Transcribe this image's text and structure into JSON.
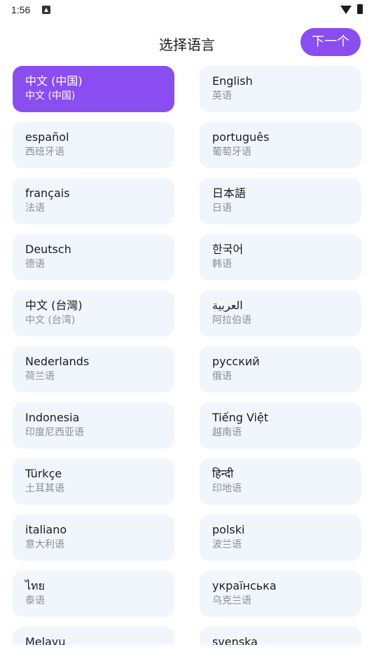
{
  "status_bar": {
    "time": "1:56",
    "notification_icon": "notification-icon",
    "wifi_icon": "wifi-icon",
    "battery_icon": "battery-icon"
  },
  "header": {
    "title": "选择语言",
    "next_label": "下一个"
  },
  "colors": {
    "accent": "#8a4df0",
    "card_bg": "#f1f6fd",
    "subtitle": "#8d8d94"
  },
  "languages": [
    {
      "native": "中文 (中国)",
      "zh": "中文 (中国)",
      "selected": true
    },
    {
      "native": "English",
      "zh": "英语",
      "selected": false
    },
    {
      "native": "español",
      "zh": "西班牙语",
      "selected": false
    },
    {
      "native": "português",
      "zh": "葡萄牙语",
      "selected": false
    },
    {
      "native": "français",
      "zh": "法语",
      "selected": false
    },
    {
      "native": "日本語",
      "zh": "日语",
      "selected": false
    },
    {
      "native": "Deutsch",
      "zh": "德语",
      "selected": false
    },
    {
      "native": "한국어",
      "zh": "韩语",
      "selected": false
    },
    {
      "native": "中文 (台灣)",
      "zh": "中文 (台湾)",
      "selected": false
    },
    {
      "native": "العربية",
      "zh": "阿拉伯语",
      "selected": false
    },
    {
      "native": "Nederlands",
      "zh": "荷兰语",
      "selected": false
    },
    {
      "native": "русский",
      "zh": "俄语",
      "selected": false
    },
    {
      "native": "Indonesia",
      "zh": "印度尼西亚语",
      "selected": false
    },
    {
      "native": "Tiếng Việt",
      "zh": "越南语",
      "selected": false
    },
    {
      "native": "Türkçe",
      "zh": "土耳其语",
      "selected": false
    },
    {
      "native": "हिन्दी",
      "zh": "印地语",
      "selected": false
    },
    {
      "native": "italiano",
      "zh": "意大利语",
      "selected": false
    },
    {
      "native": "polski",
      "zh": "波兰语",
      "selected": false
    },
    {
      "native": "ไทย",
      "zh": "泰语",
      "selected": false
    },
    {
      "native": "українська",
      "zh": "乌克兰语",
      "selected": false
    },
    {
      "native": "Melayu",
      "zh": "",
      "selected": false
    },
    {
      "native": "svenska",
      "zh": "",
      "selected": false
    }
  ]
}
